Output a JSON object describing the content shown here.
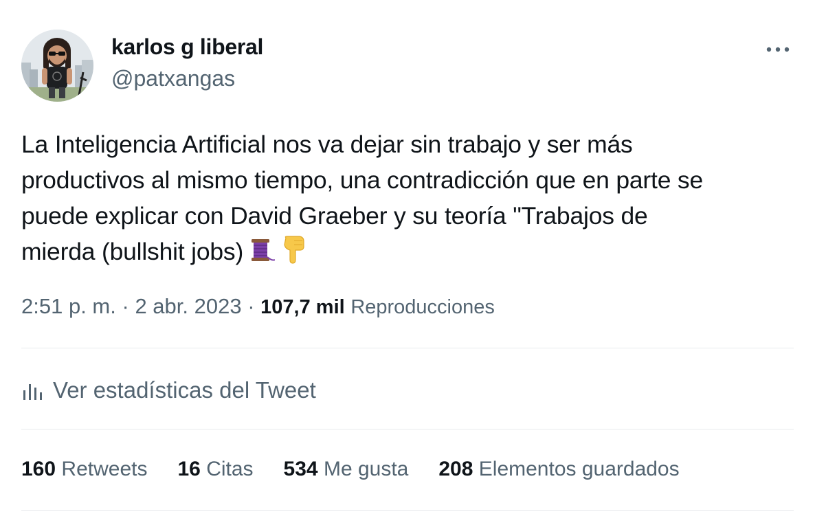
{
  "tweet": {
    "author": {
      "display_name": "karlos g liberal",
      "handle": "@patxangas",
      "avatar_icon": "cartoon-avatar-icon"
    },
    "more_icon": "more-dots-icon",
    "text_lines": [
      "La Inteligencia Artificial nos va dejar sin trabajo y ser más",
      "productivos al mismo tiempo, una contradicción que en parte se",
      "puede explicar con David Graeber y su teoría \"Trabajos de",
      "mierda (bullshit jobs)"
    ],
    "emojis": [
      "thread-spool-emoji",
      "pointing-down-emoji"
    ],
    "meta": {
      "time": "2:51 p. m.",
      "separator": "·",
      "date": "2 abr. 2023",
      "views_count": "107,7 mil",
      "views_label": "Reproducciones"
    },
    "stats_link": {
      "icon": "bar-chart-icon",
      "label": "Ver estadísticas del Tweet"
    },
    "engagement": [
      {
        "count": "160",
        "label": "Retweets"
      },
      {
        "count": "16",
        "label": "Citas"
      },
      {
        "count": "534",
        "label": "Me gusta"
      },
      {
        "count": "208",
        "label": "Elementos guardados"
      }
    ],
    "colors": {
      "text_primary": "#0f1419",
      "text_secondary": "#536471",
      "divider": "#e7eaed"
    }
  }
}
